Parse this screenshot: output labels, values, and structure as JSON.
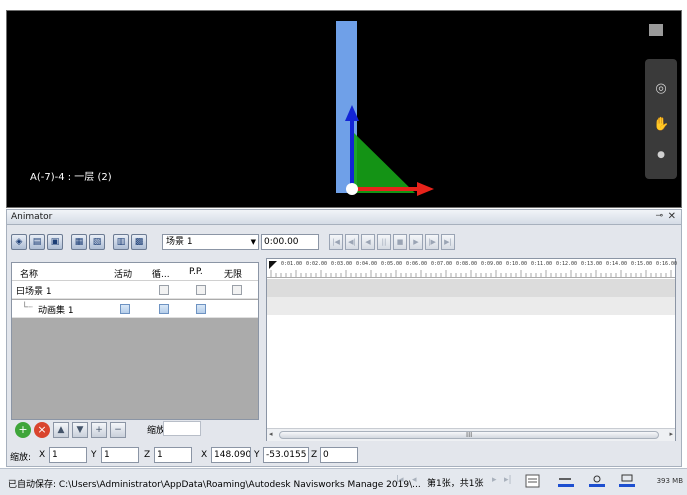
{
  "viewport": {
    "location_label": "A(-7)-4 : 一层 (2)",
    "colors": {
      "background": "#000000",
      "axis_x": "#e8231b",
      "axis_y": "#1224d6",
      "gizmo_green": "#16a317",
      "bar": "#6fa0e8"
    }
  },
  "animator": {
    "title": "Animator",
    "scene_select": "场景 1",
    "time": "0:00.00",
    "tree": {
      "columns": [
        "名称",
        "活动",
        "循...",
        "P.P.",
        "无限"
      ],
      "rows": [
        {
          "label": "曰场景 1"
        },
        {
          "label": "动画集 1"
        }
      ]
    },
    "timeline": {
      "ticks": [
        "0:01.00",
        "0:02.00",
        "0:03.00",
        "0:04.00",
        "0:05.00",
        "0:06.00",
        "0:07.00",
        "0:08.00",
        "0:09.00",
        "0:10.00",
        "0:11.00",
        "0:12.00",
        "0:13.00",
        "0:14.00",
        "0:15.00",
        "0:16.00"
      ],
      "scroll_grip": "III"
    },
    "scale_label": "缩放:",
    "fields": {
      "scale_label": "缩放:",
      "x_label": "X",
      "x_value": "1",
      "y_label": "Y",
      "y_value": "1",
      "z_label": "Z",
      "z_value": "1",
      "pos_x_label": "X",
      "pos_x_value": "148.0904",
      "pos_y_label": "Y",
      "pos_y_value": "-53.0155",
      "pos_z_label": "Z",
      "pos_z_value": "0"
    }
  },
  "status_bar": {
    "autosave_text": "已自动保存: C:\\Users\\Administrator\\AppData\\Roaming\\Autodesk Navisworks Manage 2019\\...",
    "page_info": "第1张，共1张",
    "memory": "393 MB"
  }
}
